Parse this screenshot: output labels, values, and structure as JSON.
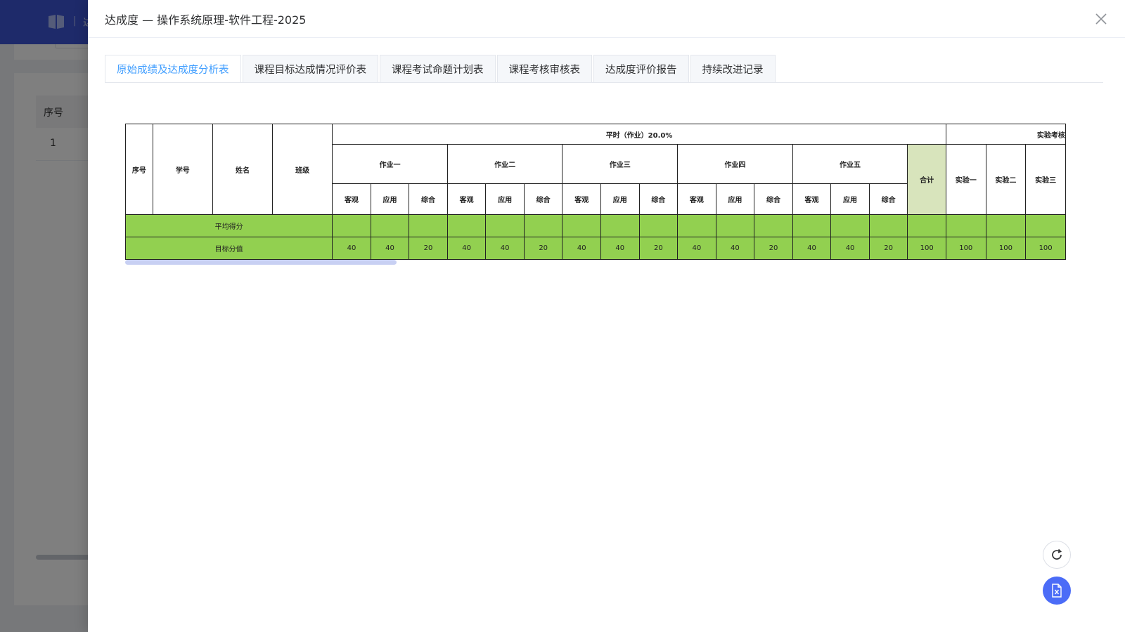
{
  "background": {
    "header_text": "达",
    "table_header": "序号",
    "row_number": "1"
  },
  "drawer": {
    "title": "达成度 — 操作系统原理-软件工程-2025",
    "tabs": [
      {
        "label": "原始成绩及达成度分析表",
        "active": true
      },
      {
        "label": "课程目标达成情况评价表",
        "active": false
      },
      {
        "label": "课程考试命题计划表",
        "active": false
      },
      {
        "label": "课程考核审核表",
        "active": false
      },
      {
        "label": "达成度评价报告",
        "active": false
      },
      {
        "label": "持续改进记录",
        "active": false
      }
    ]
  },
  "table": {
    "fixed_headers": [
      "序号",
      "学号",
      "姓名",
      "班级"
    ],
    "group_usual": "平时（作业）20.0%",
    "group_lab": "实验考核",
    "homeworks": [
      "作业一",
      "作业二",
      "作业三",
      "作业四",
      "作业五"
    ],
    "sub_columns": [
      "客观",
      "应用",
      "综合"
    ],
    "sum_label": "合计",
    "labs": [
      "实验一",
      "实验二",
      "实验三"
    ],
    "avg_row_label": "平均得分",
    "target_row_label": "目标分值",
    "target_values": [
      "40",
      "40",
      "20",
      "40",
      "40",
      "20",
      "40",
      "40",
      "20",
      "40",
      "40",
      "20",
      "40",
      "40",
      "20",
      "100",
      "100",
      "100",
      "100"
    ]
  },
  "colors": {
    "accent": "#409eff",
    "header_blue": "#3c55d4",
    "row_green": "#92d050",
    "sum_header": "#d8e4bc",
    "export_button": "#4b6cf7"
  },
  "icons": {
    "close": "close-icon",
    "refresh": "refresh-icon",
    "export": "excel-file-icon",
    "logo": "book-icon"
  }
}
